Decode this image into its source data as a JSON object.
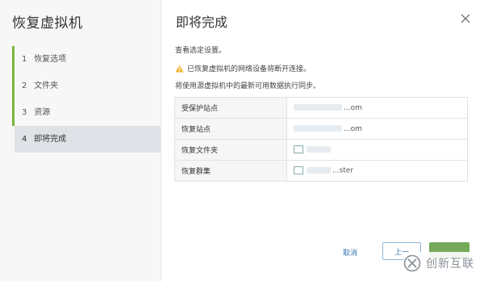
{
  "rail": {
    "title": "恢复虚拟机",
    "steps": [
      {
        "num": "1",
        "label": "恢复选项"
      },
      {
        "num": "2",
        "label": "文件夹"
      },
      {
        "num": "3",
        "label": "资源"
      },
      {
        "num": "4",
        "label": "即将完成"
      }
    ]
  },
  "main": {
    "title": "即将完成",
    "line1": "查看选定设置。",
    "warning": "已恢复虚拟机的网络设备将断开连接。",
    "line3": "将使用源虚拟机中的最新可用数据执行同步。",
    "rows": [
      {
        "key": "受保护站点",
        "value": "...om"
      },
      {
        "key": "恢复站点",
        "value": "...om"
      },
      {
        "key": "恢复文件夹",
        "value": ""
      },
      {
        "key": "恢复群集",
        "value": "...ster"
      }
    ]
  },
  "footer": {
    "cancel": "取消",
    "back": "上一",
    "finish": ""
  },
  "watermark": {
    "text": "创新互联"
  },
  "colors": {
    "accent_green": "#78b63d",
    "link_blue": "#3a78b5",
    "warning_yellow": "#f2b530"
  }
}
